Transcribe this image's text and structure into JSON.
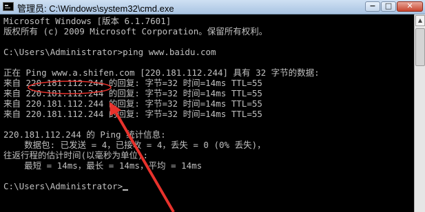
{
  "window": {
    "title": "管理员: C:\\Windows\\system32\\cmd.exe",
    "icon": "cmd-icon",
    "controls": {
      "minimize": "−",
      "maximize": "□",
      "close": "✕"
    }
  },
  "console": {
    "lines": [
      "Microsoft Windows [版本 6.1.7601]",
      "版权所有 (c) 2009 Microsoft Corporation。保留所有权利。",
      "",
      "C:\\Users\\Administrator>ping www.baidu.com",
      "",
      "正在 Ping www.a.shifen.com [220.181.112.244] 具有 32 字节的数据:",
      "来自 220.181.112.244 的回复: 字节=32 时间=14ms TTL=55",
      "来自 220.181.112.244 的回复: 字节=32 时间=14ms TTL=55",
      "来自 220.181.112.244 的回复: 字节=32 时间=14ms TTL=55",
      "来自 220.181.112.244 的回复: 字节=32 时间=14ms TTL=55",
      "",
      "220.181.112.244 的 Ping 统计信息:",
      "    数据包: 已发送 = 4，已接收 = 4，丢失 = 0 (0% 丢失)，",
      "往返行程的估计时间(以毫秒为单位):",
      "    最短 = 14ms，最长 = 14ms，平均 = 14ms",
      "",
      "C:\\Users\\Administrator>"
    ],
    "text_color": "#c0c0c0",
    "background": "#000000"
  },
  "annotation": {
    "color": "#e8322c"
  }
}
